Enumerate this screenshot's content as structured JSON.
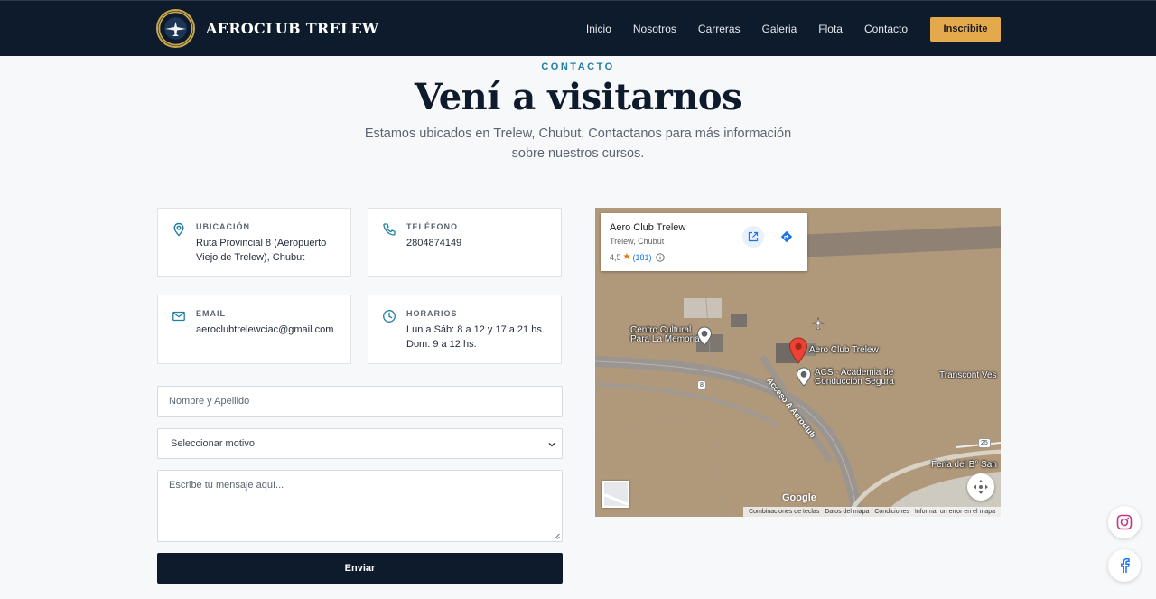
{
  "header": {
    "brand": "AEROCLUB TRELEW",
    "nav": [
      "Inicio",
      "Nosotros",
      "Carreras",
      "Galeria",
      "Flota",
      "Contacto"
    ],
    "cta": "Inscribite"
  },
  "hero": {
    "eyebrow": "CONTACTO",
    "title": "Vení a visitarnos",
    "subtitle": "Estamos ubicados en Trelew, Chubut. Contactanos para más información sobre nuestros cursos."
  },
  "info": {
    "location": {
      "label": "UBICACIÓN",
      "value": "Ruta Provincial 8 (Aeropuerto Viejo de Trelew), Chubut",
      "icon": "map-pin-icon"
    },
    "phone": {
      "label": "TELÉFONO",
      "value": "2804874149",
      "icon": "phone-icon"
    },
    "email": {
      "label": "EMAIL",
      "value": "aeroclubtrelewciac@gmail.com",
      "icon": "mail-icon"
    },
    "hours": {
      "label": "HORARIOS",
      "line1": "Lun a Sáb: 8 a 12 y 17 a 21 hs.",
      "line2": "Dom: 9 a 12 hs.",
      "icon": "clock-icon"
    }
  },
  "form": {
    "name_placeholder": "Nombre y Apellido",
    "motive_selected": "Seleccionar motivo",
    "message_placeholder": "Escribe tu mensaje aquí...",
    "submit": "Enviar"
  },
  "map": {
    "place_name": "Aero Club Trelew",
    "place_sub": "Trelew, Chubut",
    "rating": "4,5",
    "review_count": "(181)",
    "labels": {
      "centro_1": "Centro Cultural",
      "centro_2": "Para La Memoria",
      "aeroclub": "Aero Club Trelew",
      "acs_1": "ACS - Academia de",
      "acs_2": "Conducción Segura",
      "transcont": "Transcont Ves",
      "feria": "Feria del B° San",
      "road": "Acceso A Aeroclub",
      "shield_8": "8",
      "shield_25": "25"
    },
    "google": "Google",
    "attribution": [
      "Combinaciones de teclas",
      "Datos del mapa",
      "Condiciones",
      "Informar un error en el mapa"
    ]
  },
  "colors": {
    "navy": "#0e1b2c",
    "accent": "#e3a94b",
    "teal": "#1e7ea3",
    "instagram": "#c13584",
    "facebook": "#1877f2"
  }
}
